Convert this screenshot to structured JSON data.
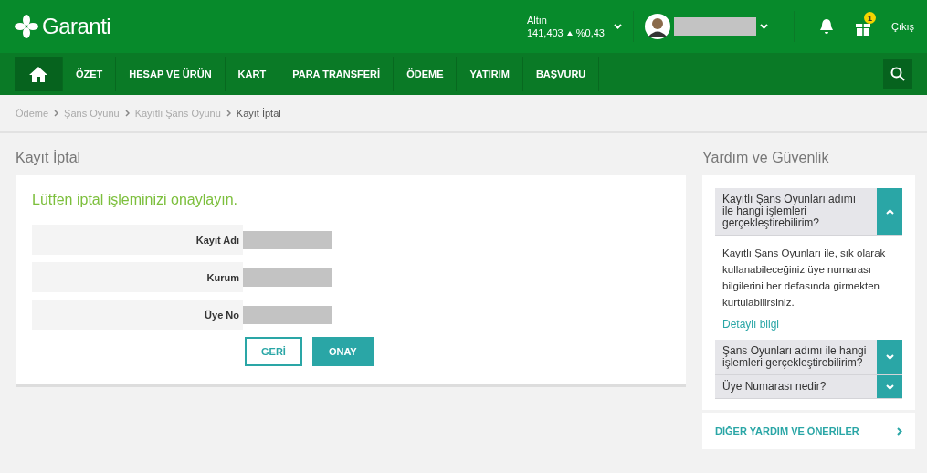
{
  "header": {
    "logo": "Garanti",
    "ticker": {
      "label": "Altın",
      "value": "141,403",
      "rising": true,
      "change": "%0,43"
    },
    "notification_count": "1",
    "logout": "Çıkış"
  },
  "nav": [
    {
      "kind": "home",
      "selected": true
    },
    {
      "label": "ÖZET",
      "selected": false
    },
    {
      "label": "HESAP VE ÜRÜN",
      "selected": false
    },
    {
      "label": "KART",
      "selected": false
    },
    {
      "label": "PARA TRANSFERİ",
      "selected": false
    },
    {
      "label": "ÖDEME",
      "selected": false
    },
    {
      "label": "YATIRIM",
      "selected": false
    },
    {
      "label": "BAŞVURU",
      "selected": false
    }
  ],
  "breadcrumb": [
    "Ödeme",
    "Şans Oyunu",
    "Kayıtlı Şans Oyunu",
    "Kayıt İptal"
  ],
  "page_title": "Kayıt İptal",
  "card": {
    "heading": "Lütfen iptal işleminizi onaylayın.",
    "fields": [
      {
        "label": "Kayıt Adı"
      },
      {
        "label": "Kurum"
      },
      {
        "label": "Üye No"
      }
    ],
    "buttons": [
      {
        "label": "GERİ",
        "kind": "secondary"
      },
      {
        "label": "ONAY",
        "kind": "primary"
      }
    ]
  },
  "help": {
    "title": "Yardım ve Güvenlik",
    "items": [
      {
        "question": "Kayıtlı Şans Oyunları adımı ile hangi işlemleri gerçekleştirebilirim?",
        "expanded": true,
        "answer": "Kayıtlı Şans Oyunları ile, sık olarak kullanabileceğiniz üye numarası bilgilerini her defasında girmekten kurtulabilirsiniz.",
        "link": "Detaylı bilgi"
      },
      {
        "question": "Şans Oyunları adımı ile hangi işlemleri gerçekleştirebilirim?",
        "expanded": false
      },
      {
        "question": "Üye Numarası nedir?",
        "expanded": false
      }
    ],
    "more": "DİĞER YARDIM VE ÖNERİLER"
  }
}
